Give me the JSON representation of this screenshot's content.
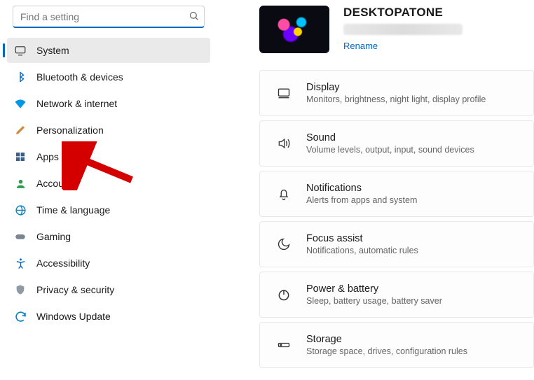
{
  "search": {
    "placeholder": "Find a setting"
  },
  "sidebar": {
    "items": [
      {
        "label": "System",
        "icon": "system"
      },
      {
        "label": "Bluetooth & devices",
        "icon": "bluetooth"
      },
      {
        "label": "Network & internet",
        "icon": "wifi"
      },
      {
        "label": "Personalization",
        "icon": "brush"
      },
      {
        "label": "Apps",
        "icon": "apps"
      },
      {
        "label": "Accounts",
        "icon": "person"
      },
      {
        "label": "Time & language",
        "icon": "clock-globe"
      },
      {
        "label": "Gaming",
        "icon": "gamepad"
      },
      {
        "label": "Accessibility",
        "icon": "accessibility"
      },
      {
        "label": "Privacy & security",
        "icon": "shield"
      },
      {
        "label": "Windows Update",
        "icon": "update"
      }
    ],
    "selected_index": 0
  },
  "header": {
    "device_name": "DESKTOPATONE",
    "rename_label": "Rename"
  },
  "cards": [
    {
      "title": "Display",
      "sub": "Monitors, brightness, night light, display profile",
      "icon": "display"
    },
    {
      "title": "Sound",
      "sub": "Volume levels, output, input, sound devices",
      "icon": "sound"
    },
    {
      "title": "Notifications",
      "sub": "Alerts from apps and system",
      "icon": "bell"
    },
    {
      "title": "Focus assist",
      "sub": "Notifications, automatic rules",
      "icon": "moon"
    },
    {
      "title": "Power & battery",
      "sub": "Sleep, battery usage, battery saver",
      "icon": "power"
    },
    {
      "title": "Storage",
      "sub": "Storage space, drives, configuration rules",
      "icon": "storage"
    }
  ],
  "annotation": {
    "kind": "arrow",
    "target": "Apps"
  }
}
